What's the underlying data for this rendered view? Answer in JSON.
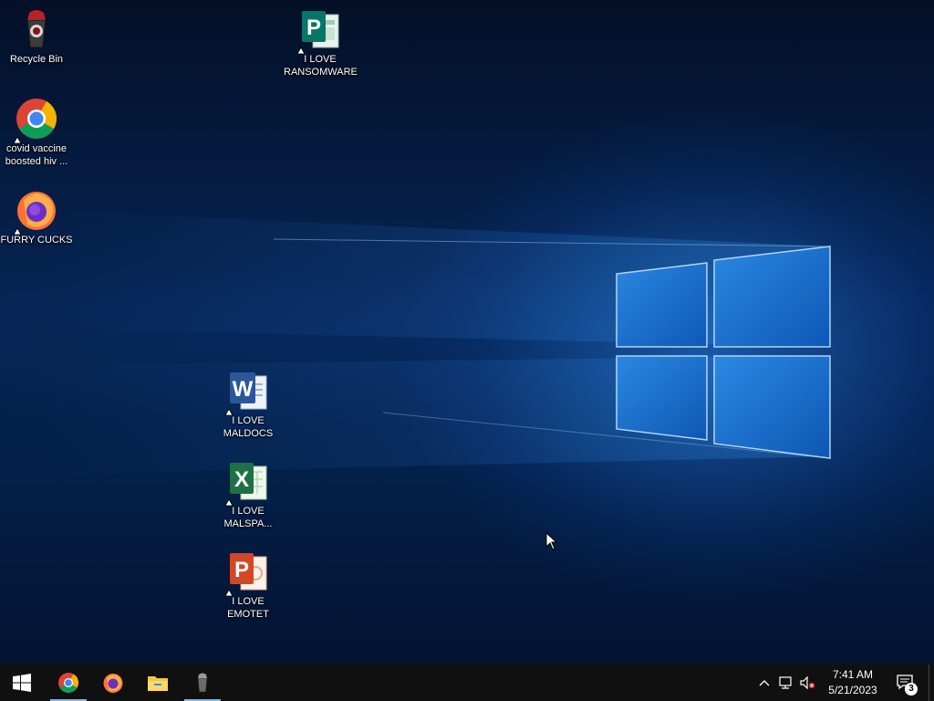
{
  "desktop": {
    "icons": [
      {
        "label": "Recycle Bin",
        "icon": "recycle-bin-icon"
      },
      {
        "label": "covid vaccine boosted hiv ...",
        "icon": "chrome-icon"
      },
      {
        "label": "FURRY CUCKS",
        "icon": "firefox-icon"
      },
      {
        "label": "I LOVE RANSOMWARE",
        "icon": "publisher-icon"
      },
      {
        "label": "I LOVE MALDOCS",
        "icon": "word-icon"
      },
      {
        "label": "I LOVE MALSPA...",
        "icon": "excel-icon"
      },
      {
        "label": "I LOVE EMOTET",
        "icon": "powerpoint-icon"
      }
    ]
  },
  "taskbar": {
    "pinned": [
      {
        "name": "start",
        "icon": "windows-start-icon"
      },
      {
        "name": "chrome",
        "icon": "chrome-icon",
        "active": true
      },
      {
        "name": "firefox",
        "icon": "firefox-icon"
      },
      {
        "name": "file-explorer",
        "icon": "folder-icon"
      },
      {
        "name": "recycle-app",
        "icon": "recycle-bin-icon",
        "active": true
      }
    ],
    "tray": {
      "time": "7:41 AM",
      "date": "5/21/2023",
      "notification_count": "3"
    }
  },
  "colors": {
    "taskbar_bg": "#101010",
    "active_indicator": "#76b9ed",
    "wallpaper_accent": "#2a8ae6"
  }
}
